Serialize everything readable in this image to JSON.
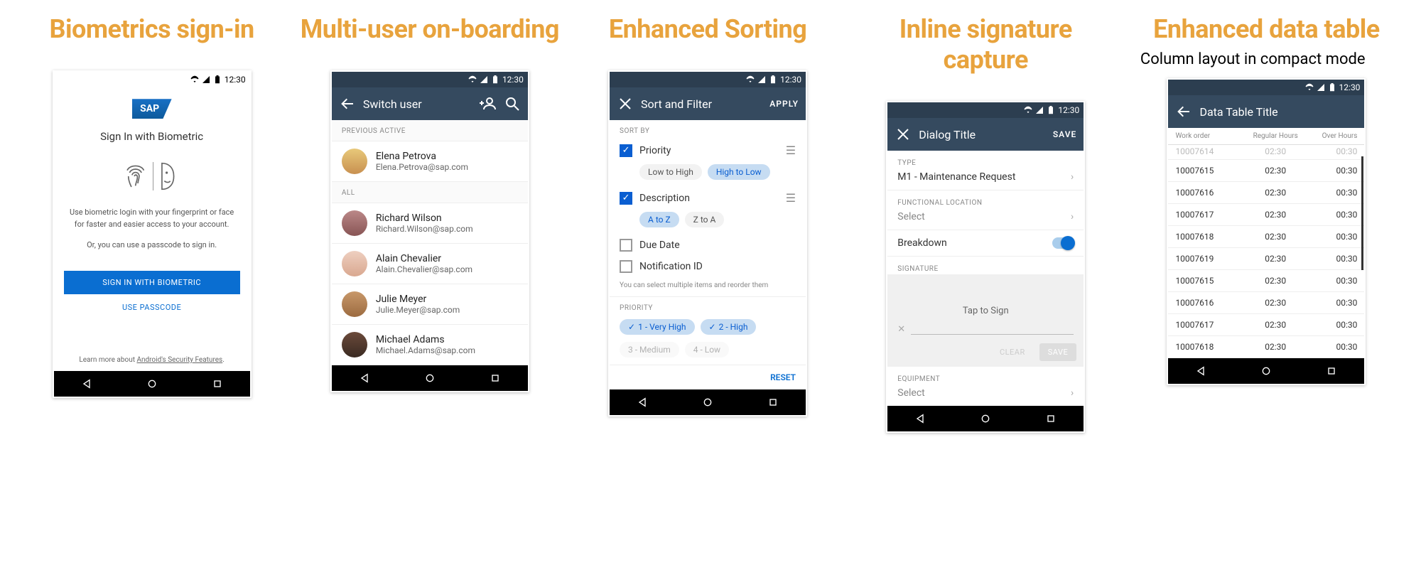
{
  "clock": "12:30",
  "columns": [
    {
      "title": "Biometrics sign-in"
    },
    {
      "title": "Multi-user on-boarding"
    },
    {
      "title": "Enhanced Sorting"
    },
    {
      "title": "Inline signature capture"
    },
    {
      "title": "Enhanced data table",
      "subtitle": "Column layout in compact mode"
    }
  ],
  "screen1": {
    "heading": "Sign In with Biometric",
    "desc": "Use biometric login with your fingerprint or face for faster and easier access to your account.",
    "or": "Or, you can use a passcode to sign in.",
    "btn_primary": "SIGN IN WITH BIOMETRIC",
    "btn_link": "USE PASSCODE",
    "learn_pre": "Learn more about ",
    "learn_link": "Android's Security Features",
    "learn_post": "."
  },
  "screen2": {
    "appbar_title": "Switch user",
    "header_prev": "PREVIOUS ACTIVE",
    "header_all": "ALL",
    "prev_user": {
      "name": "Elena Petrova",
      "email": "Elena.Petrova@sap.com"
    },
    "all_users": [
      {
        "name": "Richard Wilson",
        "email": "Richard.Wilson@sap.com"
      },
      {
        "name": "Alain Chevalier",
        "email": "Alain.Chevalier@sap.com"
      },
      {
        "name": "Julie Meyer",
        "email": "Julie.Meyer@sap.com"
      },
      {
        "name": "Michael Adams",
        "email": "Michael.Adams@sap.com"
      }
    ]
  },
  "screen3": {
    "appbar_title": "Sort and Filter",
    "apply": "APPLY",
    "sortby_h": "SORT BY",
    "items": [
      {
        "label": "Priority",
        "checked": true,
        "options": [
          "Low to High",
          "High to Low"
        ],
        "active": 1
      },
      {
        "label": "Description",
        "checked": true,
        "options": [
          "A to Z",
          "Z to A"
        ],
        "active": 0
      },
      {
        "label": "Due Date",
        "checked": false
      },
      {
        "label": "Notification ID",
        "checked": false
      }
    ],
    "hint": "You can select multiple items and reorder them",
    "priority_h": "PRIORITY",
    "priority_chips": [
      "1 - Very High",
      "2 - High"
    ],
    "priority_chips_off": [
      "3 - Medium",
      "4 - Low"
    ],
    "reset": "RESET"
  },
  "screen4": {
    "appbar_title": "Dialog Title",
    "save": "SAVE",
    "type_label": "TYPE",
    "type_value": "M1 - Maintenance Request",
    "func_label": "FUNCTIONAL LOCATION",
    "func_value": "Select",
    "breakdown_label": "Breakdown",
    "sig_label": "SIGNATURE",
    "sig_tap": "Tap to Sign",
    "clear": "CLEAR",
    "save2": "SAVE",
    "equip_label": "EQUIPMENT",
    "equip_value": "Select"
  },
  "screen5": {
    "appbar_title": "Data Table Title",
    "headers": [
      "Work order",
      "Regular Hours",
      "Over Hours"
    ],
    "cut_row": [
      "10007614",
      "02:30",
      "00:30"
    ],
    "rows": [
      [
        "10007615",
        "02:30",
        "00:30"
      ],
      [
        "10007616",
        "02:30",
        "00:30"
      ],
      [
        "10007617",
        "02:30",
        "00:30"
      ],
      [
        "10007618",
        "02:30",
        "00:30"
      ],
      [
        "10007619",
        "02:30",
        "00:30"
      ],
      [
        "10007615",
        "02:30",
        "00:30"
      ],
      [
        "10007616",
        "02:30",
        "00:30"
      ],
      [
        "10007617",
        "02:30",
        "00:30"
      ],
      [
        "10007618",
        "02:30",
        "00:30"
      ]
    ]
  }
}
